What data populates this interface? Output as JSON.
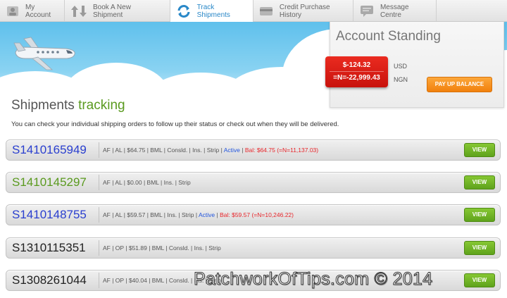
{
  "nav": {
    "tabs": [
      {
        "label": "My Account",
        "icon": "user-icon",
        "active": false
      },
      {
        "label": "Book A New Shipment",
        "icon": "arrows-icon",
        "active": false
      },
      {
        "label": "Track Shipments",
        "icon": "refresh-icon",
        "active": true
      },
      {
        "label": "Credit Purchase History",
        "icon": "credit-card-icon",
        "active": false
      },
      {
        "label": "Message Centre",
        "icon": "message-icon",
        "active": false
      }
    ]
  },
  "account": {
    "title": "Account Standing",
    "usd_balance": "$-124.32",
    "ngn_balance": "=N=-22,999.43",
    "usd_label": "USD",
    "ngn_label": "NGN",
    "pay_button": "PAY UP BALANCE"
  },
  "page": {
    "heading_main": "Shipments",
    "heading_accent": "tracking",
    "description": "You can check your individual shipping orders to follow up their status or check out when they will be delivered."
  },
  "shipments": [
    {
      "number": "S1410165949",
      "number_color": "#2a3fcf",
      "details": "AF | AL | $64.75 | BML | Consld. | Ins. | Strip |",
      "status": "Active",
      "balance": "Bal: $64.75 (=N=11,137.03)",
      "view": "VIEW"
    },
    {
      "number": "S1410145297",
      "number_color": "#5a9a1f",
      "details": "AF | AL | $0.00 | BML | Ins. | Strip",
      "status": "",
      "balance": "",
      "view": "VIEW"
    },
    {
      "number": "S1410148755",
      "number_color": "#2a3fcf",
      "details": "AF | AL | $59.57 | BML | Ins. | Strip |",
      "status": "Active",
      "balance": "Bal: $59.57 (=N=10,246.22)",
      "view": "VIEW"
    },
    {
      "number": "S1310115351",
      "number_color": "#222222",
      "details": "AF | OP | $51.89 | BML | Consld. | Ins. | Strip",
      "status": "",
      "balance": "",
      "view": "VIEW"
    },
    {
      "number": "S1308261044",
      "number_color": "#222222",
      "details": "AF | OP | $40.04 | BML | Consld. | Ins. | Strip",
      "status": "",
      "balance": "",
      "view": "VIEW"
    }
  ],
  "watermark": "PatchworkOfTips.com © 2014",
  "colors": {
    "accent_blue": "#2a88c8",
    "accent_green": "#5a9a1f",
    "debit_red": "#e8252a",
    "pay_orange": "#f39018"
  }
}
